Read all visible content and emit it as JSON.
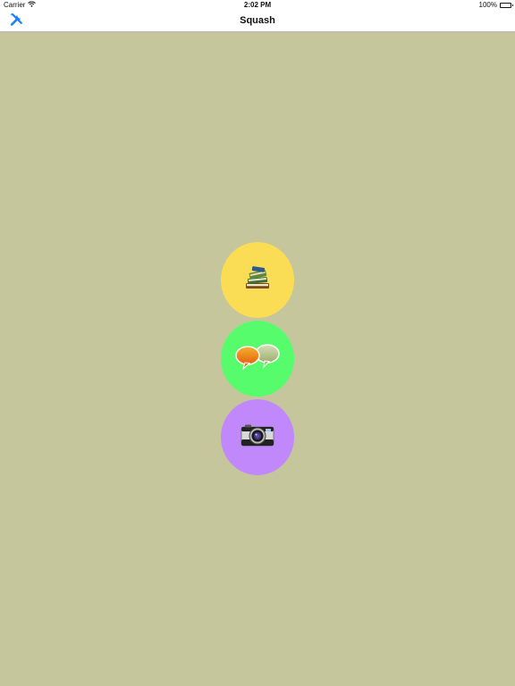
{
  "status_bar": {
    "carrier": "Carrier",
    "time": "2:02 PM",
    "battery": "100%",
    "wifi_icon": "wifi-icon",
    "battery_icon": "battery-icon"
  },
  "nav_bar": {
    "title": "Squash",
    "left_icon": "tools-icon",
    "accent_color": "#1a82fb"
  },
  "background_color": "#c5c69c",
  "circles": [
    {
      "icon": "books-icon",
      "color": "#fbdd55"
    },
    {
      "icon": "chat-bubbles-icon",
      "color": "#57fc6d"
    },
    {
      "icon": "camera-icon",
      "color": "#c188fb"
    }
  ]
}
